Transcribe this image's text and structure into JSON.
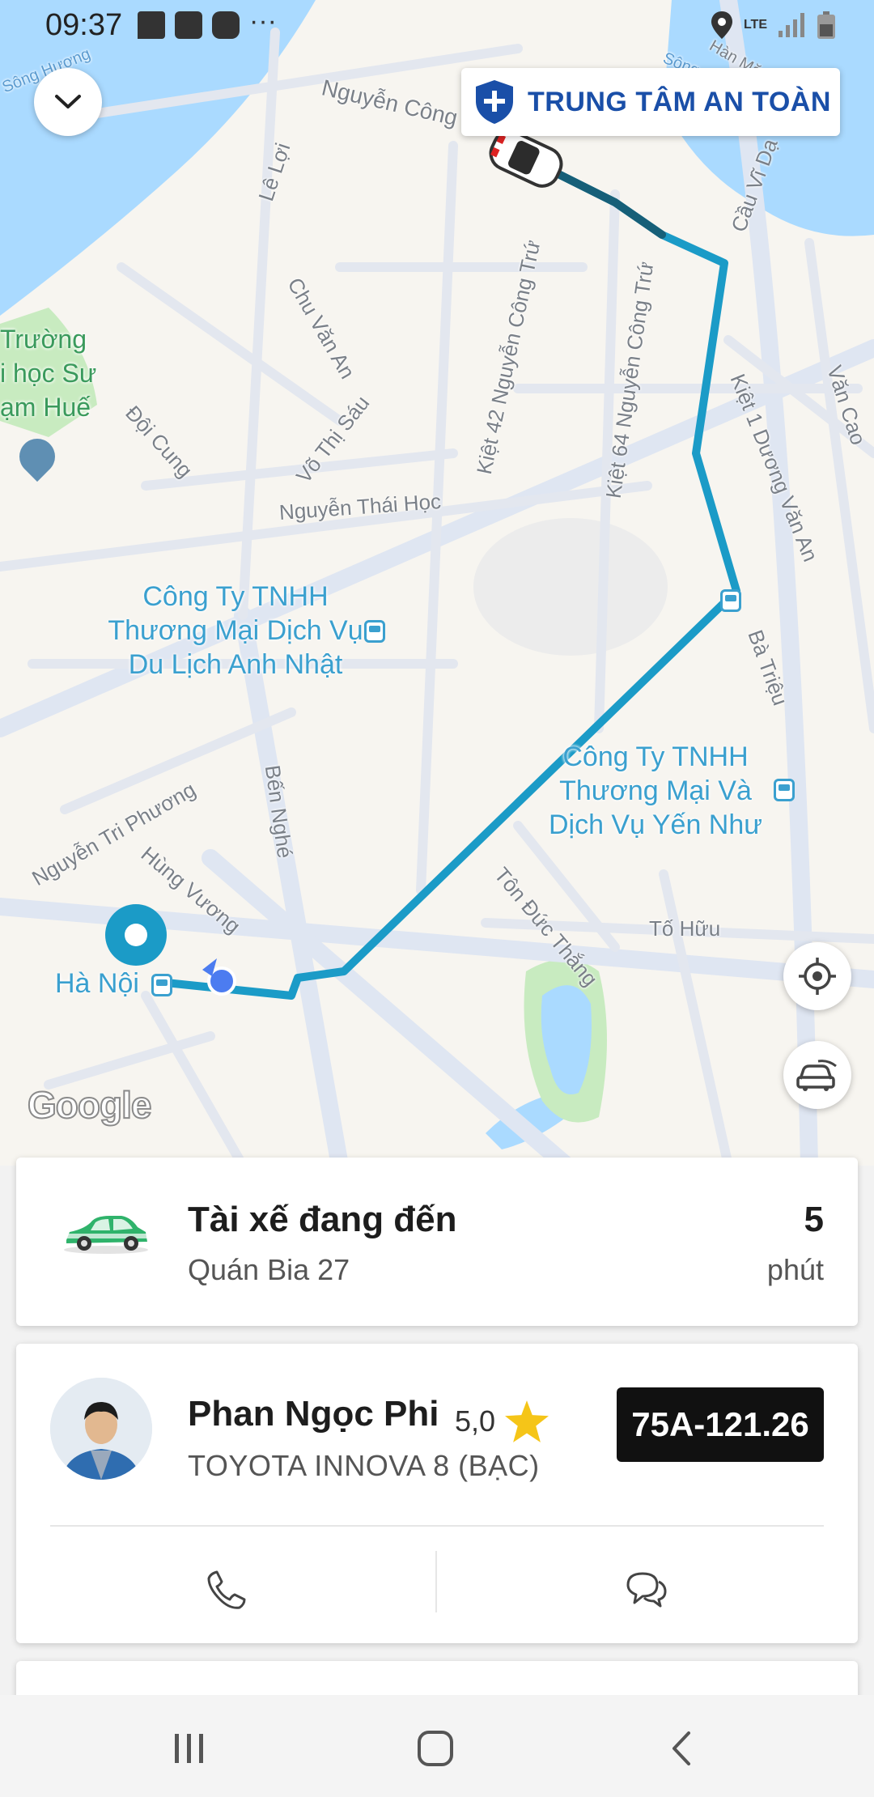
{
  "status_bar": {
    "time": "09:37",
    "network": "LTE",
    "icons": [
      "message-icon",
      "gallery-icon",
      "app-icon",
      "more-dots-icon",
      "location-icon",
      "signal-icon",
      "battery-icon"
    ]
  },
  "map": {
    "street_labels": [
      "Nguyễn Công Trứ",
      "Lê Lợi",
      "Chu Văn An",
      "Kiệt 42 Nguyễn Công Trứ",
      "Kiệt 64 Nguyễn Công Trứ",
      "Cầu Vĩ Dạ",
      "Kiệt 1 Dương Văn An",
      "Văn Cao",
      "Đội Cung",
      "Võ Thị Sáu",
      "Nguyễn Thái Học",
      "Bà Triệu",
      "Bến Nghé",
      "Nguyễn Tri Phương",
      "Hùng Vương",
      "Tôn Đức Thắng",
      "Tố Hữu",
      "Sông Hương",
      "Hàn Mặc Tử",
      "Sông"
    ],
    "place_labels": {
      "school": "Trường\ni học Sư\nạm Huế",
      "poi_1": "Công Ty TNHH\nThương Mại Dịch Vụ\nDu Lịch Anh Nhật",
      "poi_2": "Công Ty TNHH\nThương Mại Và\nDịch Vụ Yến Như",
      "destination": "Hà Nội"
    },
    "attribution": "Google",
    "colors": {
      "water": "#aadaff",
      "route": "#1b9bc7",
      "park": "#c8ebc0",
      "land": "#f7f5f0",
      "road": "#dfe6f2"
    }
  },
  "safety_center": {
    "label": "TRUNG TÂM AN TOÀN"
  },
  "controls": {
    "collapse": "chevron-down-icon",
    "locate": "locate-icon",
    "car": "car-view-icon"
  },
  "arrival_card": {
    "title": "Tài xế đang đến",
    "pickup": "Quán Bia 27",
    "eta_value": "5",
    "eta_unit": "phút"
  },
  "driver_card": {
    "name": "Phan Ngọc Phi",
    "rating": "5,0",
    "vehicle": "TOYOTA INNOVA 8 (BẠC)",
    "plate": "75A-121.26"
  },
  "accent": {
    "brand_green": "#00b14f",
    "star": "#f5c518",
    "plate_bg": "#111111"
  }
}
